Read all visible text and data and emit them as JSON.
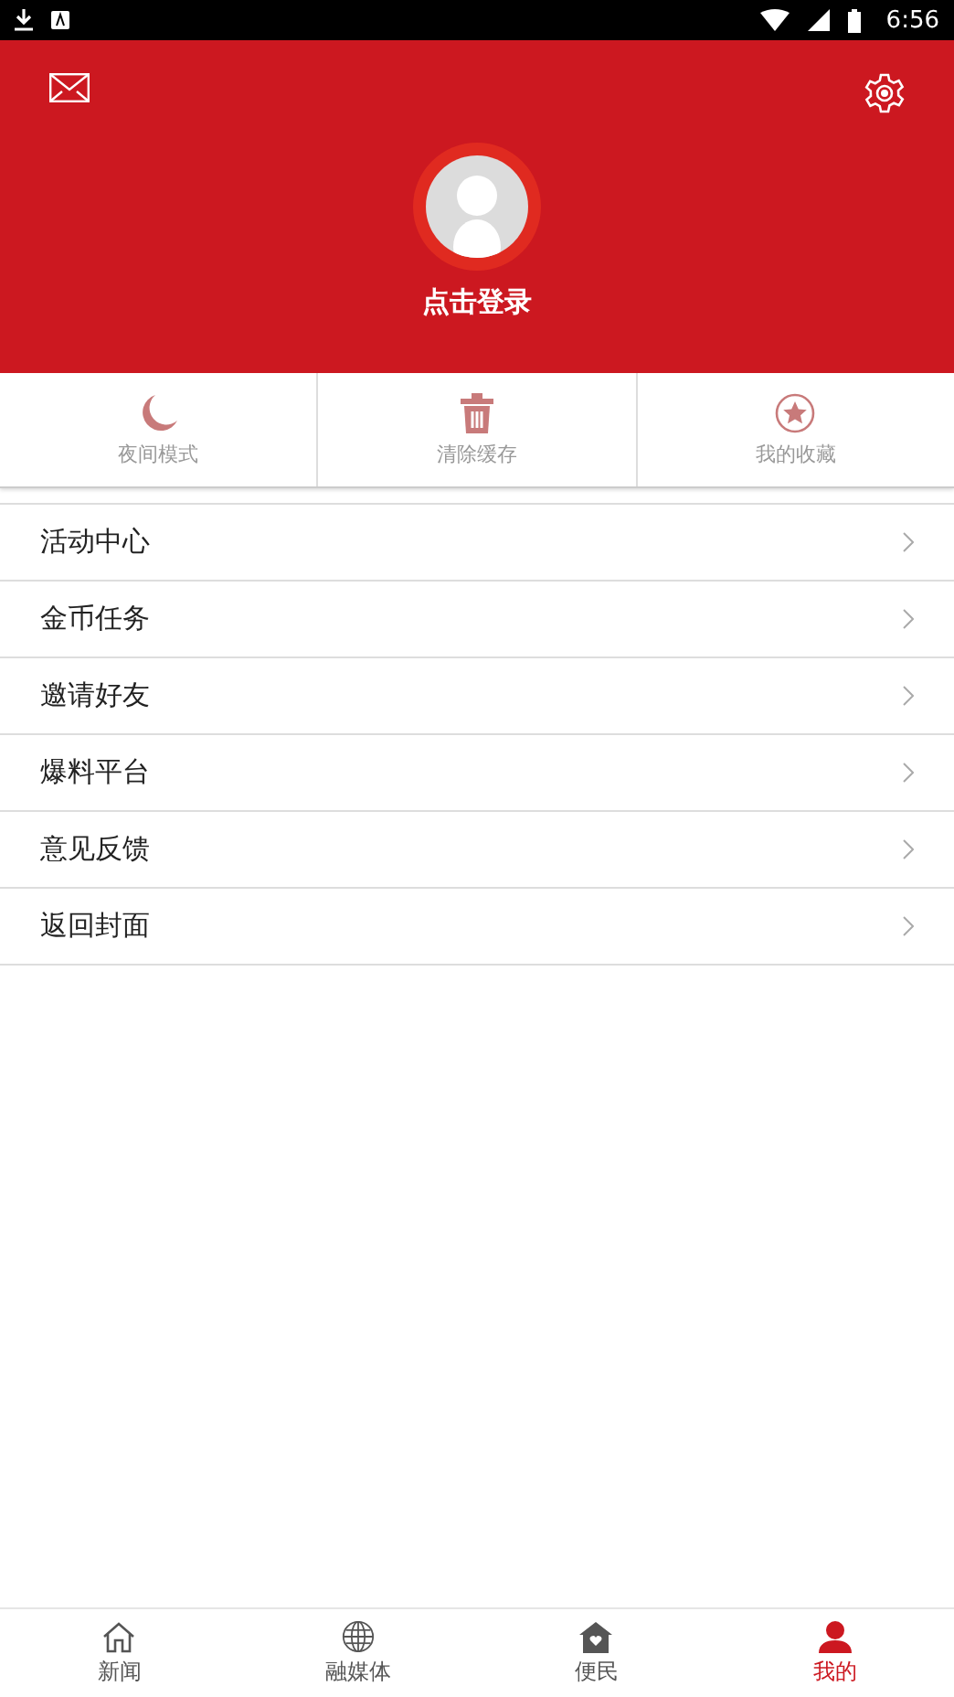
{
  "status_bar": {
    "time": "6:56"
  },
  "header": {
    "login_label": "点击登录"
  },
  "quick_actions": [
    {
      "kind": "moon",
      "label": "夜间模式"
    },
    {
      "kind": "trash",
      "label": "清除缓存"
    },
    {
      "kind": "star",
      "label": "我的收藏"
    }
  ],
  "menu": [
    {
      "label": "活动中心"
    },
    {
      "label": "金币任务"
    },
    {
      "label": "邀请好友"
    },
    {
      "label": "爆料平台"
    },
    {
      "label": "意见反馈"
    },
    {
      "label": "返回封面"
    }
  ],
  "nav": [
    {
      "kind": "home",
      "label": "新闻",
      "selected": false
    },
    {
      "kind": "globe",
      "label": "融媒体",
      "selected": false
    },
    {
      "kind": "house",
      "label": "便民",
      "selected": false
    },
    {
      "kind": "person",
      "label": "我的",
      "selected": true
    }
  ]
}
